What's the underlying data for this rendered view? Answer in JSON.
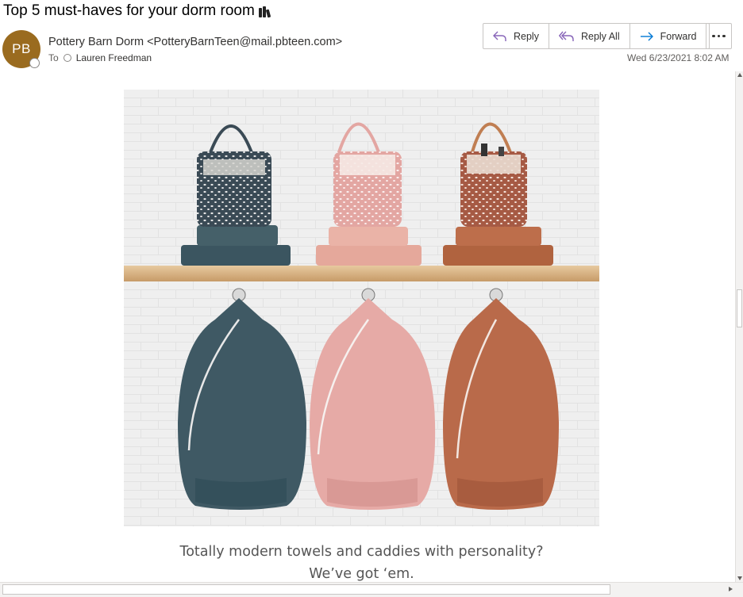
{
  "email": {
    "subject": "Top 5 must-haves for your dorm room",
    "subject_icon": "books-emoji",
    "sender_initials": "PB",
    "sender_avatar_color": "#9a6b1f",
    "from": "Pottery Barn Dorm <PotteryBarnTeen@mail.pbteen.com>",
    "to_label": "To",
    "to_name": "Lauren  Freedman",
    "date": "Wed 6/23/2021 8:02 AM"
  },
  "actions": {
    "reply": "Reply",
    "reply_all": "Reply All",
    "forward": "Forward",
    "more_icon": "ellipsis-icon",
    "accent": "#8764b8",
    "forward_accent": "#0078d4"
  },
  "body": {
    "hero_image": "shower caddies, towels and laundry backpacks in navy, blush and rust on a wall shelf",
    "caption_line1": "Totally modern towels and caddies with personality?",
    "caption_line2": "We’ve got ‘em."
  }
}
